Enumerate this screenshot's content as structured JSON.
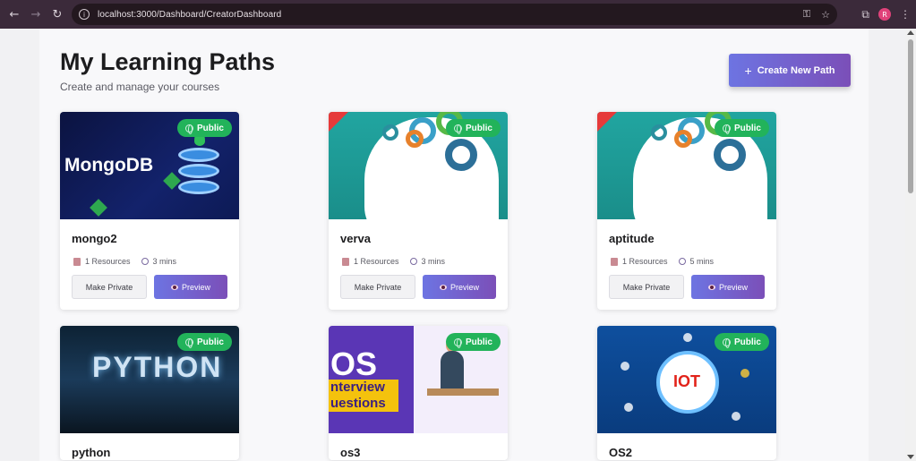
{
  "browser": {
    "url": "localhost:3000/Dashboard/CreatorDashboard",
    "profile_initial": "R"
  },
  "header": {
    "title": "My Learning Paths",
    "subtitle": "Create and manage your courses",
    "create_button": "Create New Path",
    "create_icon": "+"
  },
  "colors": {
    "accent_gradient_start": "#6d74e2",
    "accent_gradient_end": "#7b4fb8",
    "public_badge": "#22b35a"
  },
  "cards": [
    {
      "title": "mongo2",
      "badge": "Public",
      "resources": "1 Resources",
      "duration": "3 mins",
      "private_label": "Make Private",
      "preview_label": "Preview",
      "image_text": "MongoDB"
    },
    {
      "title": "verva",
      "badge": "Public",
      "resources": "1 Resources",
      "duration": "3 mins",
      "private_label": "Make Private",
      "preview_label": "Preview"
    },
    {
      "title": "aptitude",
      "badge": "Public",
      "resources": "1 Resources",
      "duration": "5 mins",
      "private_label": "Make Private",
      "preview_label": "Preview"
    },
    {
      "title": "python",
      "badge": "Public",
      "image_text": "PYTHON"
    },
    {
      "title": "os3",
      "badge": "Public",
      "image_text": "OS",
      "image_band_1": "nterview",
      "image_band_2": "uestions"
    },
    {
      "title": "OS2",
      "badge": "Public",
      "image_text": "IOT"
    }
  ]
}
